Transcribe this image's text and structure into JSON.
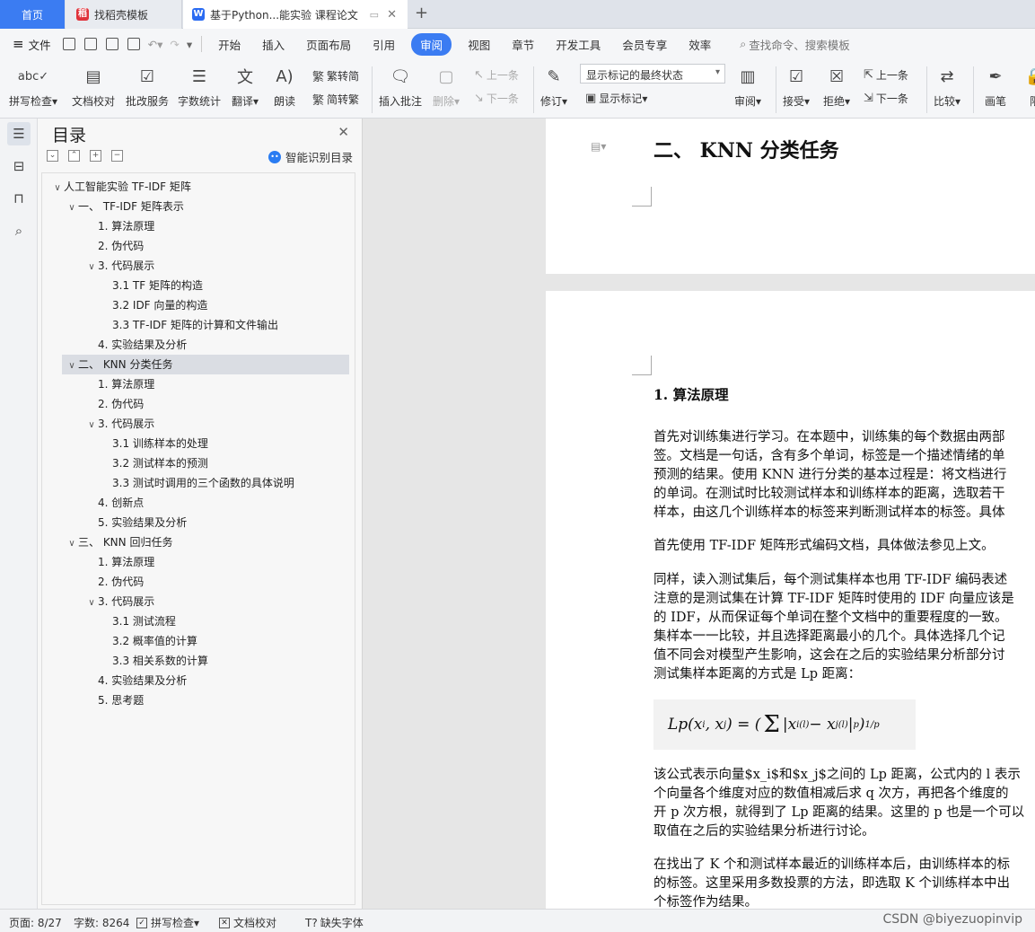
{
  "tabs": {
    "home": "首页",
    "template": "找稻壳模板",
    "document": "基于Python...能实验 课程论文",
    "add": "+"
  },
  "menu": {
    "file": "文件",
    "items": [
      "开始",
      "插入",
      "页面布局",
      "引用",
      "审阅",
      "视图",
      "章节",
      "开发工具",
      "会员专享",
      "效率"
    ],
    "active": "审阅",
    "search": "查找命令、搜索模板"
  },
  "ribbon": {
    "spell": "拼写检查",
    "proof": "文档校对",
    "approve": "批改服务",
    "wordcount": "字数统计",
    "translate": "翻译",
    "read": "朗读",
    "to_trad": "繁转简",
    "to_simp": "简转繁",
    "insert_comment": "插入批注",
    "delete": "删除",
    "prev": "上一条",
    "next": "下一条",
    "track": "修订",
    "markup_state": "显示标记的最终状态",
    "show_markup": "显示标记",
    "review": "审阅",
    "accept": "接受",
    "reject": "拒绝",
    "prev2": "上一条",
    "next2": "下一条",
    "compare": "比较",
    "pen": "画笔",
    "limit": "限"
  },
  "toc": {
    "title": "目录",
    "smart": "智能识别目录",
    "items": [
      {
        "text": "人工智能实验 TF-IDF 矩阵",
        "level": 0,
        "expand": true
      },
      {
        "text": "一、 TF-IDF 矩阵表示",
        "level": 1,
        "expand": true
      },
      {
        "text": "1. 算法原理",
        "level": 2
      },
      {
        "text": "2. 伪代码",
        "level": 2
      },
      {
        "text": "3. 代码展示",
        "level": 2,
        "expand": true
      },
      {
        "text": "3.1 TF 矩阵的构造",
        "level": 3
      },
      {
        "text": "3.2 IDF 向量的构造",
        "level": 3
      },
      {
        "text": "3.3 TF-IDF 矩阵的计算和文件输出",
        "level": 3
      },
      {
        "text": "4. 实验结果及分析",
        "level": 2
      },
      {
        "text": "二、 KNN 分类任务",
        "level": 1,
        "expand": true,
        "selected": true
      },
      {
        "text": "1. 算法原理",
        "level": 2
      },
      {
        "text": "2. 伪代码",
        "level": 2
      },
      {
        "text": "3. 代码展示",
        "level": 2,
        "expand": true
      },
      {
        "text": "3.1 训练样本的处理",
        "level": 3
      },
      {
        "text": "3.2 测试样本的预测",
        "level": 3
      },
      {
        "text": "3.3 测试时调用的三个函数的具体说明",
        "level": 3
      },
      {
        "text": "4. 创新点",
        "level": 2
      },
      {
        "text": "5. 实验结果及分析",
        "level": 2
      },
      {
        "text": "三、 KNN 回归任务",
        "level": 1,
        "expand": true
      },
      {
        "text": "1. 算法原理",
        "level": 2
      },
      {
        "text": "2. 伪代码",
        "level": 2
      },
      {
        "text": "3. 代码展示",
        "level": 2,
        "expand": true
      },
      {
        "text": "3.1 测试流程",
        "level": 3
      },
      {
        "text": "3.2 概率值的计算",
        "level": 3
      },
      {
        "text": "3.3 相关系数的计算",
        "level": 3
      },
      {
        "text": "4. 实验结果及分析",
        "level": 2
      },
      {
        "text": "5. 思考题",
        "level": 2
      }
    ]
  },
  "doc": {
    "heading2": "二、 KNN 分类任务",
    "heading3": "1. 算法原理",
    "para1": [
      "首先对训练集进行学习。在本题中，训练集的每个数据由两部",
      "签。文档是一句话，含有多个单词，标签是一个描述情绪的单",
      "预测的结果。使用 KNN 进行分类的基本过程是：将文档进行",
      "的单词。在测试时比较测试样本和训练样本的距离，选取若干",
      "样本，由这几个训练样本的标签来判断测试样本的标签。具体"
    ],
    "para2": [
      "首先使用 TF-IDF 矩阵形式编码文档，具体做法参见上文。"
    ],
    "para3": [
      "同样，读入测试集后，每个测试集样本也用 TF-IDF 编码表述",
      "注意的是测试集在计算 TF-IDF 矩阵时使用的 IDF 向量应该是",
      "的 IDF，从而保证每个单词在整个文档中的重要程度的一致。",
      "集样本一一比较，并且选择距离最小的几个。具体选择几个记",
      "值不同会对模型产生影响，这会在之后的实验结果分析部分讨",
      "测试集样本距离的方式是 Lp 距离："
    ],
    "para4": [
      "该公式表示向量$x_i$和$x_j$之间的 Lp 距离，公式内的 l 表示",
      "个向量各个维度对应的数值相减后求 q 次方，再把各个维度的",
      "开 p 次方根，就得到了 Lp 距离的结果。这里的 p 也是一个可以",
      "取值在之后的实验结果分析进行讨论。"
    ],
    "para5": [
      "在找出了 K 个和测试样本最近的训练样本后，由训练样本的标",
      "的标签。这里采用多数投票的方法，即选取 K 个训练样本中出",
      "个标签作为结果。"
    ]
  },
  "status": {
    "page": "页面: 8/27",
    "words": "字数: 8264",
    "spell": "拼写检查",
    "proof": "文档校对",
    "missing_font": "缺失字体",
    "watermark": "CSDN @biyezuopinvip"
  }
}
